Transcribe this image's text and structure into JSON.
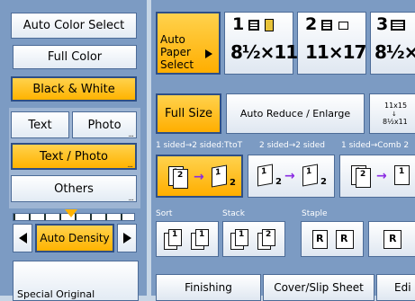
{
  "color_mode": {
    "auto_color": "Auto Color Select",
    "full_color": "Full Color",
    "black_white": "Black & White"
  },
  "original_type": {
    "text": "Text",
    "photo": "Photo",
    "text_photo": "Text / Photo",
    "others": "Others"
  },
  "density": {
    "label": "Auto Density"
  },
  "paper": {
    "auto_select": "Auto Paper Select",
    "trays": [
      {
        "num": "1",
        "size": "8½×11"
      },
      {
        "num": "2",
        "size": "11×17"
      },
      {
        "num": "3",
        "size": "8½×1"
      }
    ]
  },
  "reduce": {
    "full_size": "Full Size",
    "auto_reduce": "Auto Reduce / Enlarge",
    "ratio_top": "11x15",
    "ratio_bottom": "8½x11"
  },
  "duplex": {
    "label1": "1 sided→2 sided:TtoT",
    "label2": "2 sided→2 sided",
    "label3": "1 sided→Comb 2"
  },
  "finish": {
    "sort": "Sort",
    "stack": "Stack",
    "staple": "Staple"
  },
  "tabs": {
    "finishing": "Finishing",
    "cover": "Cover/Slip Sheet",
    "edit": "Edi"
  },
  "bottom_left": "Special Original",
  "colors": {
    "accent": "#ffb300",
    "panel": "#7c9bc3",
    "border": "#2e4f86"
  }
}
